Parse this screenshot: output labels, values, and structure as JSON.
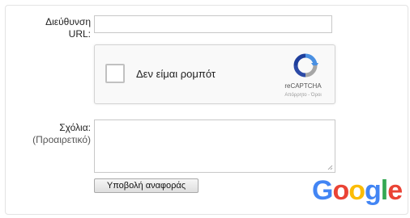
{
  "form": {
    "url_label_line1": "Διεύθυνση",
    "url_label_line2": "URL:",
    "comments_label": "Σχόλια:",
    "comments_optional": "(Προαιρετικό)",
    "submit_label": "Υποβολή αναφοράς"
  },
  "recaptcha": {
    "checkbox_text": "Δεν είμαι ρομπότ",
    "brand": "reCAPTCHA",
    "terms": "Απόρρητο - Όροι"
  },
  "footer": {
    "logo_letters": [
      "G",
      "o",
      "o",
      "g",
      "l",
      "e"
    ]
  },
  "colors": {
    "google_blue": "#4285F4",
    "google_red": "#EA4335",
    "google_yellow": "#FBBC05",
    "google_green": "#34A853"
  }
}
